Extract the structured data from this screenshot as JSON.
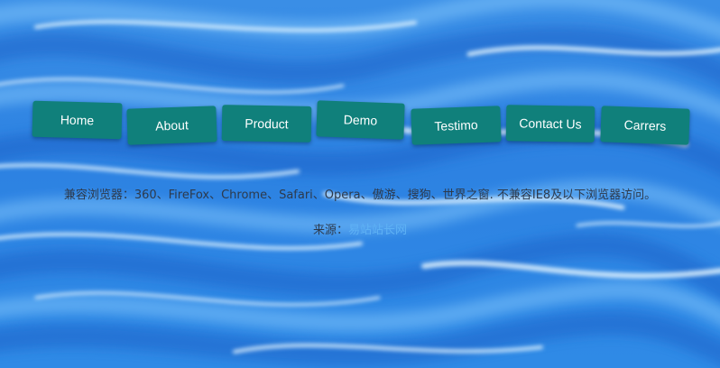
{
  "colors": {
    "nav_button": "#10807b",
    "nav_text": "#ffffff",
    "body_text": "#2d3a4c",
    "link": "#5fb2f5",
    "background": "#2f86e6"
  },
  "nav": {
    "items": [
      {
        "label": "Home"
      },
      {
        "label": "About"
      },
      {
        "label": "Product"
      },
      {
        "label": "Demo"
      },
      {
        "label": "Testimo"
      },
      {
        "label": "Contact Us"
      },
      {
        "label": "Carrers"
      }
    ]
  },
  "info": {
    "compat_text": "兼容浏览器：360、FireFox、Chrome、Safari、Opera、傲游、搜狗、世界之窗. 不兼容IE8及以下浏览器访问。",
    "source_label": "来源：",
    "source_link": "易站站长网"
  }
}
